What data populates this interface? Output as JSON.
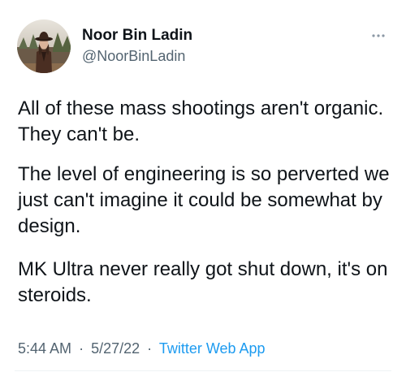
{
  "author": {
    "display_name": "Noor Bin Ladin",
    "handle": "@NoorBinLadin"
  },
  "icons": {
    "avatar": "profile-photo",
    "more": "more-options-icon"
  },
  "tweet": {
    "paragraphs": [
      "All of these mass shootings aren't organic. They can't be.",
      "The level of engineering is so perverted we just can't imagine it could be somewhat by design.",
      "MK Ultra never really got shut down, it's on steroids."
    ],
    "time": "5:44 AM",
    "date": "5/27/22",
    "separator": "·",
    "source": "Twitter Web App"
  },
  "colors": {
    "text": "#0f1419",
    "secondary": "#536471",
    "link": "#1d9bf0",
    "divider": "#eff3f4"
  }
}
